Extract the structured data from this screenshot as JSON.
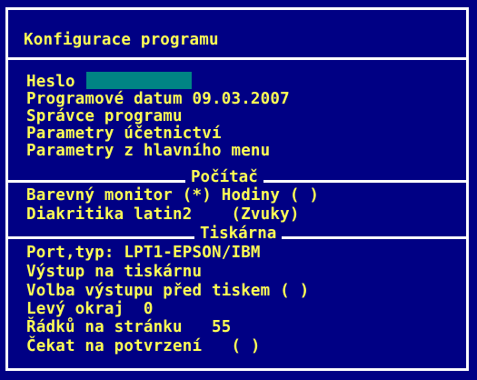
{
  "dialog": {
    "title": "Konfigurace programu"
  },
  "general": {
    "password_label": "Heslo",
    "program_date": "Programové datum 09.03.2007",
    "program_admin": "Správce programu",
    "accounting_params": "Parametry účetnictví",
    "main_menu_params": "Parametry z hlavního menu"
  },
  "computer": {
    "section_title": "Počítač",
    "color_monitor": "Barevný monitor (*) Hodiny ( )",
    "diacritics": "Diakritika latin2    (Zvuky)"
  },
  "printer": {
    "section_title": "Tiskárna",
    "port_type": "Port,typ: LPT1-EPSON/IBM",
    "output_to_printer": "Výstup na tiskárnu",
    "output_choice": "Volba výstupu před tiskem ( )",
    "left_margin": "Levý okraj  0",
    "lines_per_page": "Řádků na stránku   55",
    "wait_confirm": "Čekat na potvrzení   ( )"
  },
  "colors": {
    "background": "#000084",
    "text": "#ffff55",
    "border": "#ffffff",
    "input": "#008484"
  }
}
